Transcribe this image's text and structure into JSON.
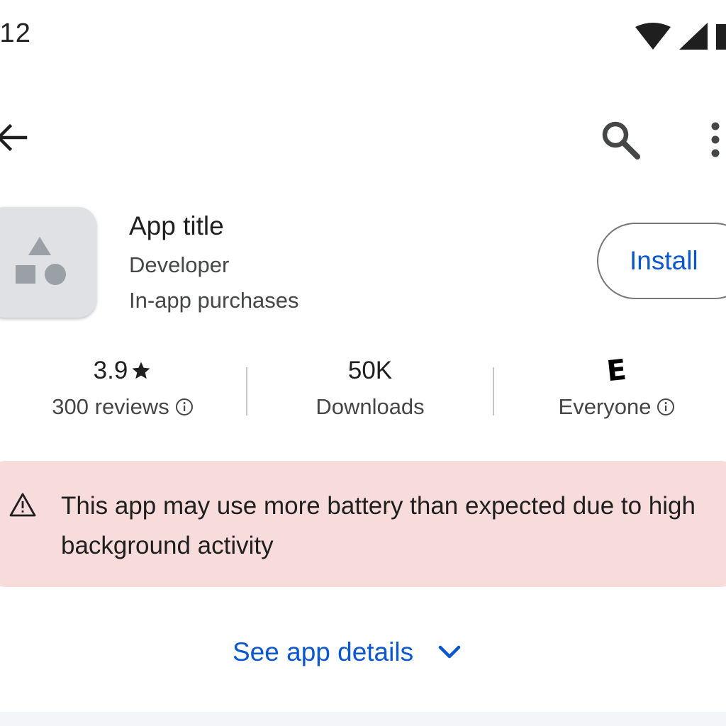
{
  "status_bar": {
    "time": ":12",
    "icons": [
      "wifi-icon",
      "cell-signal-icon",
      "battery-icon"
    ]
  },
  "top_bar": {
    "icons": [
      "back-arrow-icon",
      "search-icon",
      "more-vert-icon"
    ]
  },
  "app": {
    "title": "App title",
    "developer": "Developer",
    "purchases": "In-app purchases",
    "install_label": "Install",
    "icon": "placeholder-shapes-icon"
  },
  "stats": {
    "rating": "3.9",
    "reviews": "300 reviews",
    "downloads_value": "50K",
    "downloads_label": "Downloads",
    "content_rating_badge": "E",
    "content_rating_label": "Everyone"
  },
  "warning": {
    "text": "This app may use more battery than expected due to high background activity",
    "icon": "warning-triangle-icon"
  },
  "details": {
    "label": "See app details",
    "icon": "chevron-down-icon"
  },
  "colors": {
    "accent": "#0b57d0",
    "warning_bg": "#f8dcdc",
    "icon_bg": "#dfe1e5",
    "icon_shape": "#9aa0a6"
  }
}
